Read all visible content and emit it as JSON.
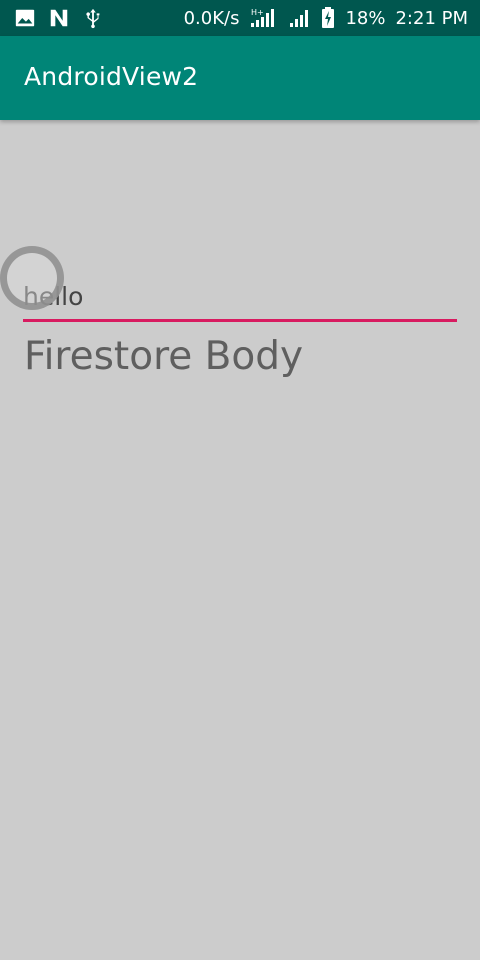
{
  "status_bar": {
    "network_speed": "0.0K/s",
    "battery": "18%",
    "time": "2:21 PM",
    "icons_left": [
      "image-icon",
      "n-icon",
      "usb-icon"
    ],
    "icons_right": [
      "signal-hplus-icon",
      "signal-icon",
      "battery-charging-icon"
    ]
  },
  "app_bar": {
    "title": "AndroidView2",
    "color": "#008577"
  },
  "content": {
    "edit_text_value": "hello",
    "underline_color": "#d81b60",
    "body_text": "Firestore Body"
  }
}
